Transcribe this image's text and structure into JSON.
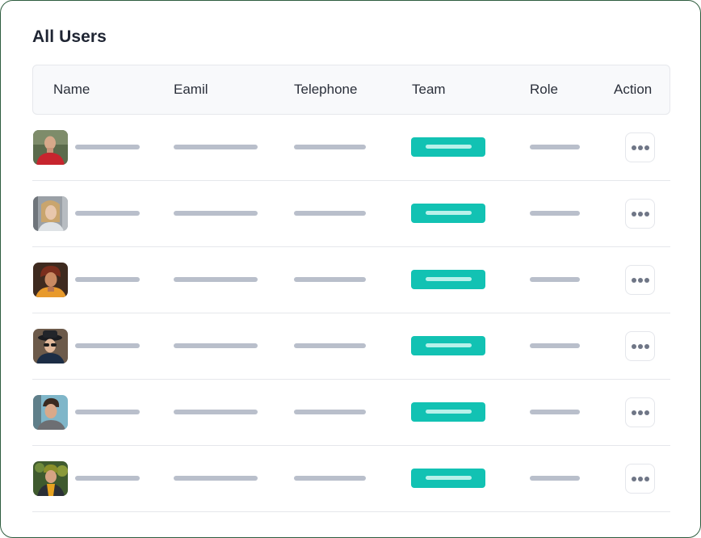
{
  "title": "All Users",
  "columns": {
    "name": "Name",
    "email": "Eamil",
    "telephone": "Telephone",
    "team": "Team",
    "role": "Role",
    "action": "Action"
  },
  "colors": {
    "team_pill": "#12c2b3",
    "placeholder_bar": "#b9bfcb",
    "border_accent": "#2f5d3f"
  },
  "rows": [
    {
      "avatar": "avatar-1"
    },
    {
      "avatar": "avatar-2"
    },
    {
      "avatar": "avatar-3"
    },
    {
      "avatar": "avatar-4"
    },
    {
      "avatar": "avatar-5"
    },
    {
      "avatar": "avatar-6"
    }
  ],
  "action_icon": "more-horizontal-icon"
}
